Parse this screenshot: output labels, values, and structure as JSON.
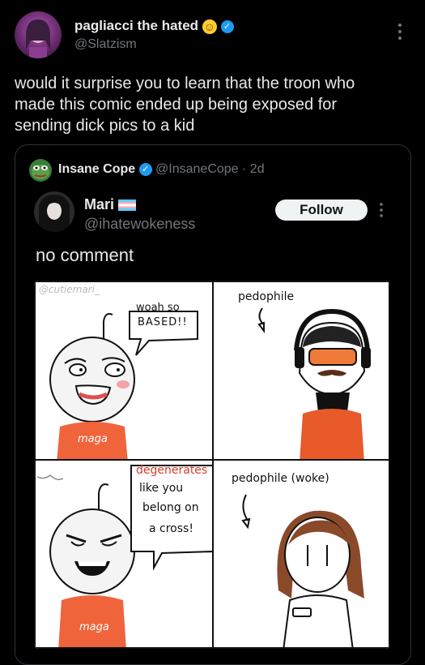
{
  "tweet": {
    "author_name": "pagliacci the hated",
    "author_handle": "@Slatzism",
    "emoji": "☺",
    "more_icon": "more-icon",
    "text_lines": [
      "would it surprise you to learn that the troon who",
      "made this comic ended up being exposed for",
      "sending dick pics to a kid"
    ]
  },
  "quote": {
    "author_name": "Insane Cope",
    "author_handle": "@InsaneCope",
    "time": "· 2d",
    "inner": {
      "author_name": "Mari",
      "author_handle": "@ihatewokeness",
      "follow_label": "Follow",
      "text": "no comment"
    }
  },
  "comic": {
    "watermark": "@cutiemari_",
    "panel1": {
      "bubble_line1": "woah so",
      "bubble_line2": "BASED!!",
      "shirt": "maga"
    },
    "panel2": {
      "label": "pedophile"
    },
    "panel3": {
      "line1": "degenerates",
      "line2": "like you",
      "line3": "belong on",
      "line4": "a cross!",
      "shirt": "maga"
    },
    "panel4": {
      "label": "pedophile (woke)"
    }
  },
  "colors": {
    "accent": "#1d9bf0",
    "shirt": "#f0643c",
    "bg": "#000000"
  }
}
